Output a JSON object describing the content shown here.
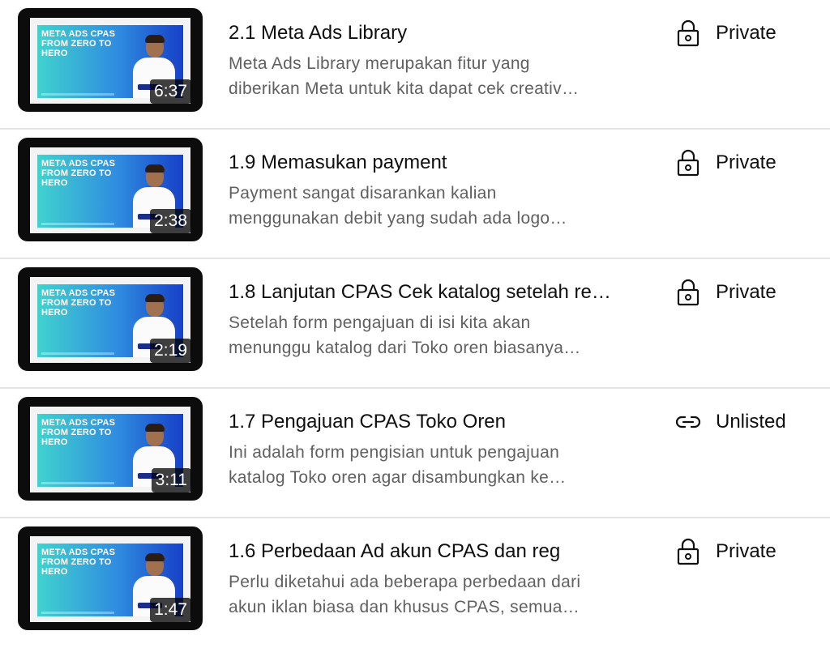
{
  "thumbnail": {
    "headline": "META ADS CPAS FROM ZERO TO HERO"
  },
  "videos": [
    {
      "title": "2.1 Meta Ads Library",
      "description_line1": "Meta Ads Library merupakan fitur yang",
      "description_line2": "diberikan Meta untuk kita dapat cek creativ…",
      "duration": "6:37",
      "visibility": "Private",
      "visibility_icon": "lock-icon"
    },
    {
      "title": "1.9 Memasukan payment",
      "description_line1": "Payment sangat disarankan kalian",
      "description_line2": "menggunakan debit yang sudah ada logo…",
      "duration": "2:38",
      "visibility": "Private",
      "visibility_icon": "lock-icon"
    },
    {
      "title": "1.8 Lanjutan CPAS Cek katalog setelah re…",
      "description_line1": "Setelah form pengajuan di isi kita akan",
      "description_line2": "menunggu katalog dari Toko oren biasanya…",
      "duration": "2:19",
      "visibility": "Private",
      "visibility_icon": "lock-icon"
    },
    {
      "title": "1.7 Pengajuan CPAS Toko Oren",
      "description_line1": "Ini adalah form pengisian untuk pengajuan",
      "description_line2": "katalog Toko oren agar disambungkan ke…",
      "duration": "3:11",
      "visibility": "Unlisted",
      "visibility_icon": "link-icon"
    },
    {
      "title": "1.6 Perbedaan Ad akun CPAS dan reg",
      "description_line1": "Perlu diketahui ada beberapa perbedaan dari",
      "description_line2": "akun iklan biasa dan khusus CPAS, semua…",
      "duration": "1:47",
      "visibility": "Private",
      "visibility_icon": "lock-icon"
    }
  ]
}
